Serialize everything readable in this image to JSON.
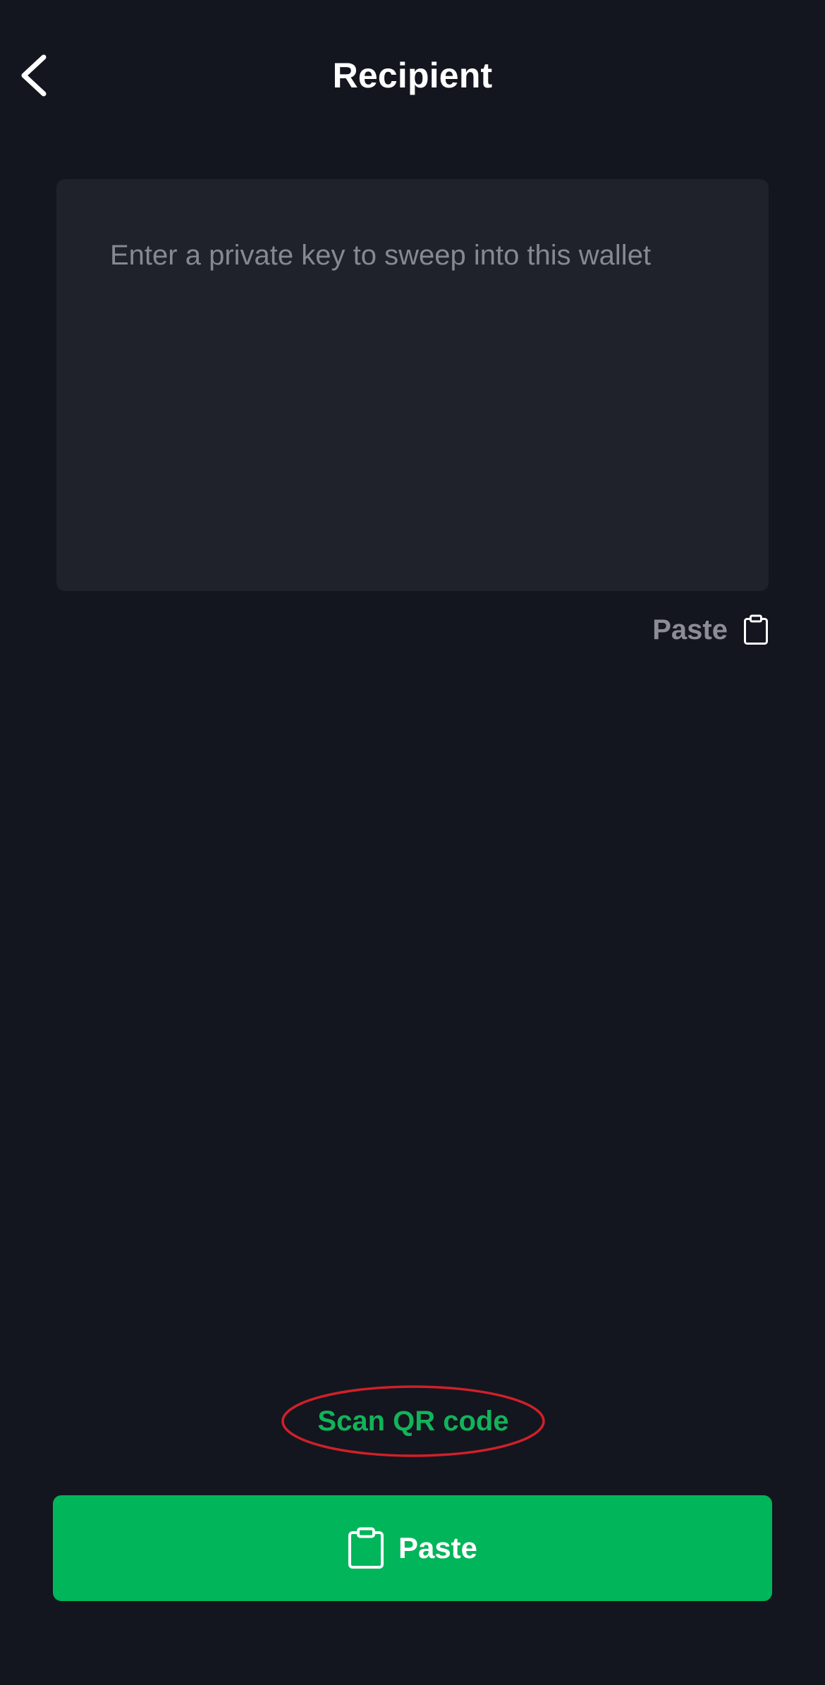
{
  "header": {
    "title": "Recipient",
    "back_icon": "chevron-left-icon"
  },
  "key_input": {
    "value": "",
    "placeholder": "Enter a private key to sweep into this wallet"
  },
  "paste_link": {
    "label": "Paste",
    "icon": "clipboard-icon"
  },
  "scan_qr": {
    "label": "Scan QR code"
  },
  "paste_button": {
    "label": "Paste",
    "icon": "clipboard-icon"
  },
  "colors": {
    "background": "#13161e",
    "input_background": "#1f212b",
    "accent_green": "#00b55a",
    "link_green": "#12b35a",
    "muted_text": "#8b8c95",
    "annotation_red": "#d0202a"
  }
}
